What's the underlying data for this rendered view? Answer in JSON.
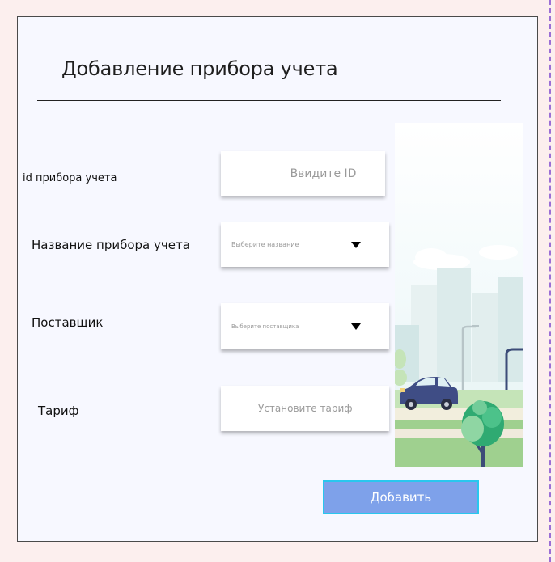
{
  "dialog": {
    "title": "Добавление прибора учета"
  },
  "form": {
    "id_label": "id прибора учета",
    "id_placeholder": "Ввидите ID",
    "name_label": "Название прибора учета",
    "name_placeholder": "Выберите название",
    "supplier_label": "Поставщик",
    "supplier_placeholder": "Выберите поставщика",
    "tariff_label": "Тариф",
    "tariff_placeholder": "Установите тариф"
  },
  "actions": {
    "add_label": "Добавить"
  },
  "colors": {
    "background": "#fcefee",
    "panel": "#f7f8ff",
    "button": "#7ea1ea",
    "button_border": "#29c7ee"
  }
}
